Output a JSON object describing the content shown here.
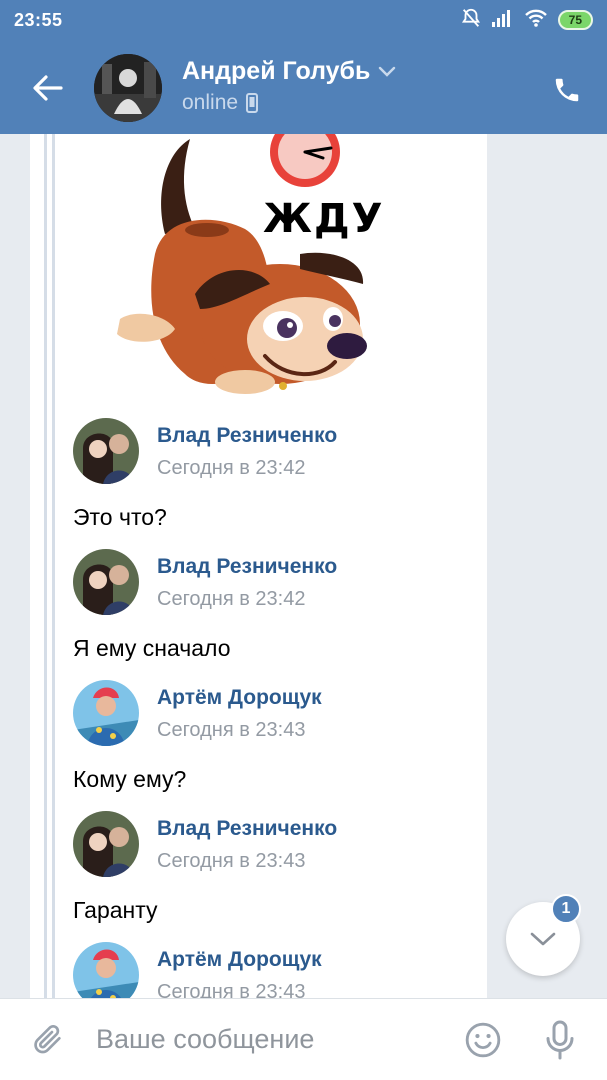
{
  "status_bar": {
    "time": "23:55",
    "battery": "75"
  },
  "header": {
    "name": "Андрей Голубь",
    "status": "online"
  },
  "sticker": {
    "caption": "ЖДУ"
  },
  "messages": [
    {
      "author": "Влад Резниченко",
      "time": "Сегодня в 23:42",
      "text": "Это что?"
    },
    {
      "author": "Влад Резниченко",
      "time": "Сегодня в 23:42",
      "text": "Я ему сначало"
    },
    {
      "author": "Артём Дорощук",
      "time": "Сегодня в 23:43",
      "text": "Кому ему?"
    },
    {
      "author": "Влад Резниченко",
      "time": "Сегодня в 23:43",
      "text": "Гаранту"
    },
    {
      "author": "Артём Дорощук",
      "time": "Сегодня в 23:43",
      "text": ""
    }
  ],
  "scroll_down": {
    "badge_count": "1"
  },
  "composer": {
    "placeholder": "Ваше сообщение"
  },
  "colors": {
    "header_bg": "#5181b8",
    "author_name": "#2b5a8e",
    "chat_bg": "#e7ebf0"
  }
}
